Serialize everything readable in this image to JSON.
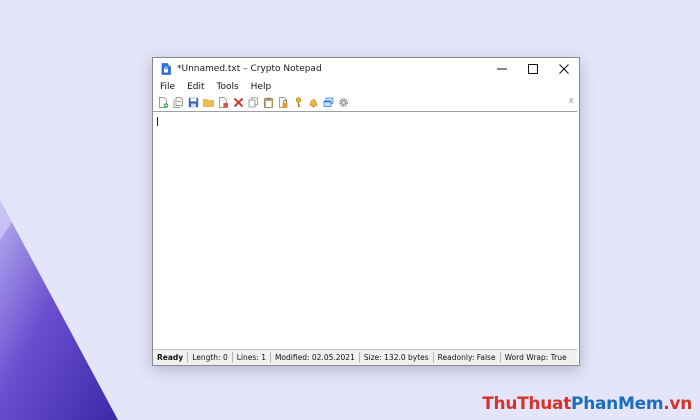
{
  "window": {
    "title": "*Unnamed.txt – Crypto Notepad"
  },
  "menu": [
    "File",
    "Edit",
    "Tools",
    "Help"
  ],
  "toolbar": {
    "icons": [
      "new-file-icon",
      "new-window-icon",
      "save-icon",
      "open-folder-icon",
      "save-as-icon",
      "delete-icon",
      "copy-icon",
      "paste-icon",
      "lock-file-icon",
      "key-icon",
      "bell-icon",
      "windows-icon",
      "gear-icon"
    ],
    "close_glyph": "x"
  },
  "status": {
    "ready": "Ready",
    "length": "Length: 0",
    "lines": "Lines: 1",
    "modified": "Modified: 02.05.2021",
    "size": "Size: 132.0 bytes",
    "readonly": "Readonly: False",
    "word_wrap": "Word Wrap: True"
  },
  "watermark": {
    "part1": "ThuThuat",
    "part2": "PhanMem",
    "part3": ".vn"
  },
  "colors": {
    "desktop": "#e4e5f8",
    "wedge": "#6a4fd0",
    "watermark_red": "#d4342c",
    "watermark_blue": "#1d6dbf"
  }
}
